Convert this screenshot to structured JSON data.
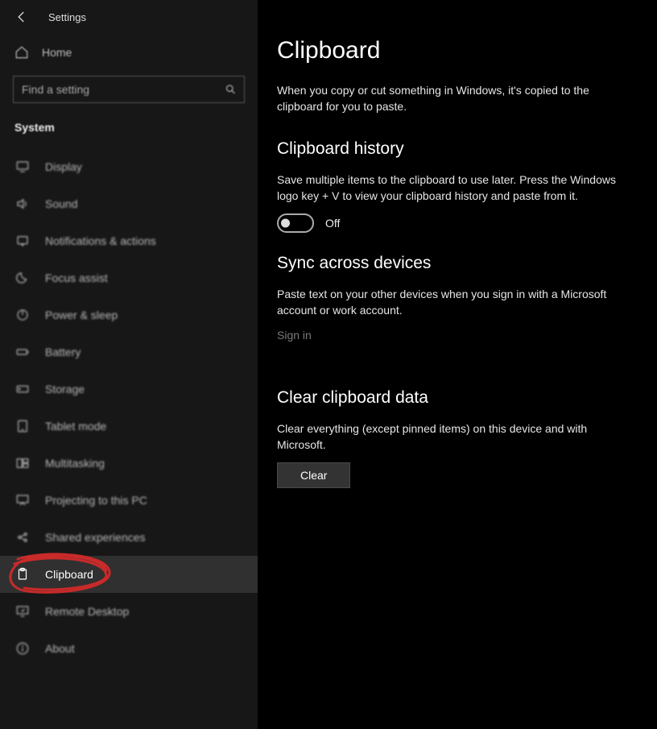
{
  "header": {
    "app_title": "Settings"
  },
  "sidebar": {
    "home_label": "Home",
    "search_placeholder": "Find a setting",
    "category": "System",
    "items": [
      {
        "label": "Display",
        "icon": "display-icon"
      },
      {
        "label": "Sound",
        "icon": "sound-icon"
      },
      {
        "label": "Notifications & actions",
        "icon": "notifications-icon"
      },
      {
        "label": "Focus assist",
        "icon": "moon-icon"
      },
      {
        "label": "Power & sleep",
        "icon": "power-icon"
      },
      {
        "label": "Battery",
        "icon": "battery-icon"
      },
      {
        "label": "Storage",
        "icon": "storage-icon"
      },
      {
        "label": "Tablet mode",
        "icon": "tablet-icon"
      },
      {
        "label": "Multitasking",
        "icon": "multitasking-icon"
      },
      {
        "label": "Projecting to this PC",
        "icon": "projecting-icon"
      },
      {
        "label": "Shared experiences",
        "icon": "shared-icon"
      },
      {
        "label": "Clipboard",
        "icon": "clipboard-icon",
        "selected": true
      },
      {
        "label": "Remote Desktop",
        "icon": "remote-icon"
      },
      {
        "label": "About",
        "icon": "info-icon"
      }
    ]
  },
  "page": {
    "title": "Clipboard",
    "intro": "When you copy or cut something in Windows, it's copied to the clipboard for you to paste.",
    "history": {
      "heading": "Clipboard history",
      "desc": "Save multiple items to the clipboard to use later. Press the Windows logo key + V to view your clipboard history and paste from it.",
      "toggle_state": "Off"
    },
    "sync": {
      "heading": "Sync across devices",
      "desc": "Paste text on your other devices when you sign in with a Microsoft account or work account.",
      "link": "Sign in"
    },
    "clear": {
      "heading": "Clear clipboard data",
      "desc": "Clear everything (except pinned items) on this device and with Microsoft.",
      "button": "Clear"
    }
  },
  "annotation": {
    "scribble_color": "#c92a2a"
  }
}
